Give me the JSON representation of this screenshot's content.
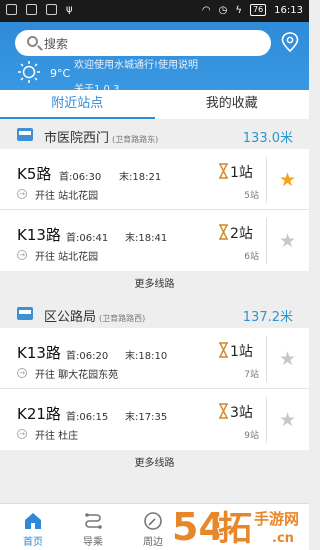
{
  "statusbar": {
    "battery": "76",
    "time": "16:13"
  },
  "header": {
    "search_placeholder": "搜索",
    "temperature": "9°C",
    "marquee": "欢迎使用水城通行!使用说明",
    "marquee2": "关于1.0.3"
  },
  "tabs": [
    {
      "label": "附近站点",
      "active": true
    },
    {
      "label": "我的收藏",
      "active": false
    }
  ],
  "stations": [
    {
      "name": "市医院西门",
      "sub": "(卫育路路东)",
      "distance": "133.0米",
      "more": "更多线路",
      "routes": [
        {
          "name": "K5路",
          "first_label": "首:06:30",
          "last_label": "末:18:21",
          "direction": "开往 站北花园",
          "stops": "1站",
          "stops_count": "5站",
          "favorited": true
        },
        {
          "name": "K13路",
          "first_label": "首:06:41",
          "last_label": "末:18:41",
          "direction": "开往 站北花园",
          "stops": "2站",
          "stops_count": "6站",
          "favorited": false
        }
      ]
    },
    {
      "name": "区公路局",
      "sub": "(卫育路路西)",
      "distance": "137.2米",
      "more": "更多线路",
      "routes": [
        {
          "name": "K13路",
          "first_label": "首:06:20",
          "last_label": "末:18:10",
          "direction": "开往 聊大花园东苑",
          "stops": "1站",
          "stops_count": "7站",
          "favorited": false
        },
        {
          "name": "K21路",
          "first_label": "首:06:15",
          "last_label": "末:17:35",
          "direction": "开往 杜庄",
          "stops": "3站",
          "stops_count": "9站",
          "favorited": false
        }
      ]
    }
  ],
  "bottom_nav": [
    {
      "label": "首页",
      "icon": "home-icon",
      "active": true
    },
    {
      "label": "导乘",
      "icon": "route-icon",
      "active": false
    },
    {
      "label": "周边",
      "icon": "nearby-icon",
      "active": false
    }
  ],
  "watermark": {
    "text": "54拓手游网",
    "domain": ".cn"
  },
  "colors": {
    "accent": "#2e8ad9",
    "header": "#3a98e2",
    "star_on": "#f5a21c",
    "star_off": "#c8c8c8",
    "hourglass": "#d08a2a",
    "distance": "#2b96d0"
  }
}
